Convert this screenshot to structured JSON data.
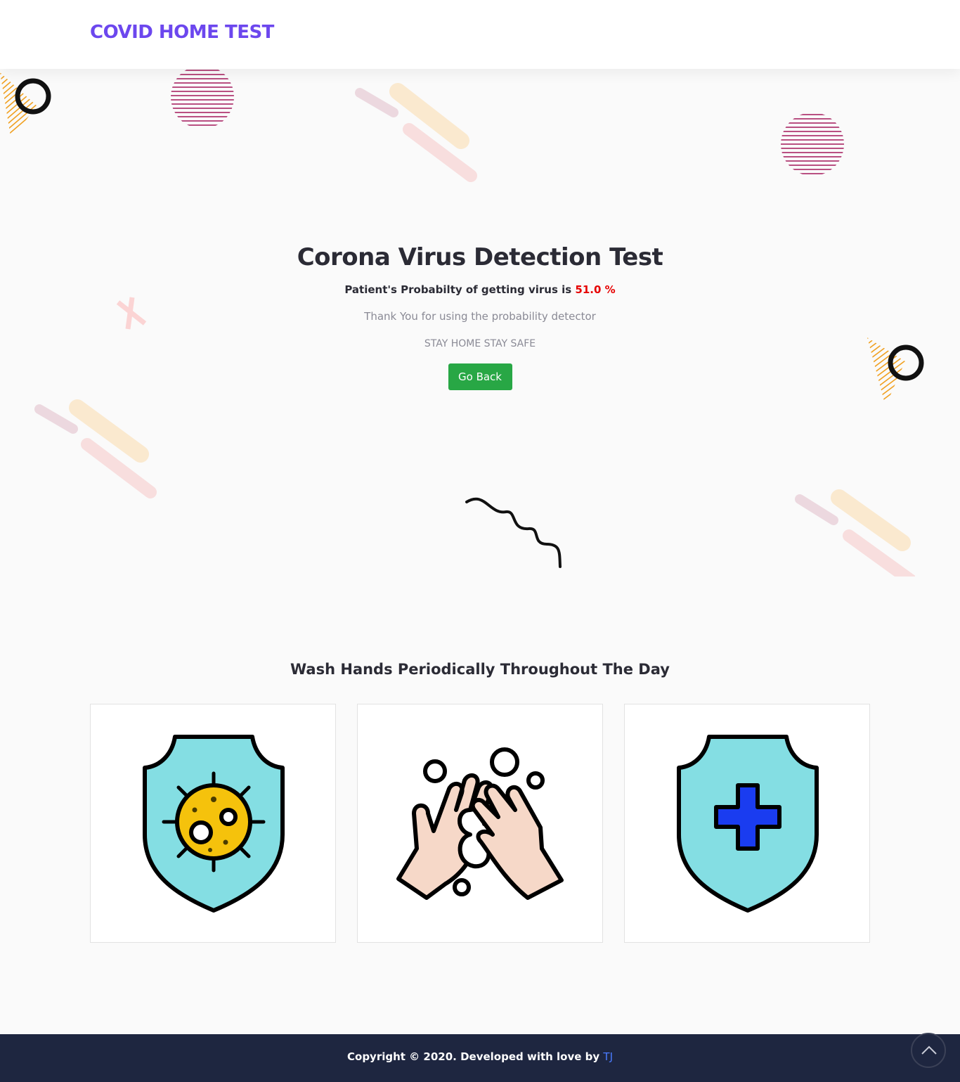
{
  "navbar": {
    "brand": "COVID HOME TEST"
  },
  "hero": {
    "title": "Corona Virus Detection Test",
    "probability_label": "Patient's Probabilty of getting virus is",
    "probability_value": "51.0 %",
    "thanks": "Thank You for using the probability detector",
    "slogan": "STAY HOME STAY SAFE",
    "go_back_label": "Go Back"
  },
  "wash_section": {
    "title": "Wash Hands Periodically Throughout The Day",
    "cards": [
      {
        "icon": "virus-shield-icon"
      },
      {
        "icon": "washing-hands-icon"
      },
      {
        "icon": "medical-shield-icon"
      }
    ]
  },
  "footer": {
    "copyright": "Copyright © 2020. Developed with love by",
    "author_link": "TJ"
  },
  "colors": {
    "brand": "#6c47ee",
    "probability": "#e60000",
    "go_back_button": "#28a745",
    "footer_bg": "#1e2640",
    "footer_link": "#4a7bff",
    "shield_fill": "#84dee3",
    "virus_fill": "#f5c20c",
    "cross_fill": "#1a3cf0",
    "skin_fill": "#f6d8c8"
  }
}
